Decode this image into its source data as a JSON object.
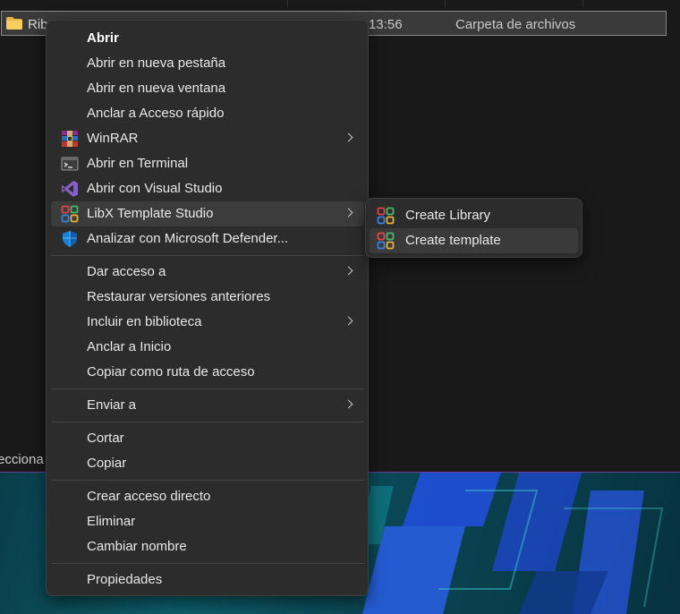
{
  "explorer": {
    "selected_row": {
      "name": "Rib",
      "time": "13:56",
      "type": "Carpeta de archivos"
    },
    "status_text": "ecciona"
  },
  "context_menu": {
    "items": [
      {
        "label": "Abrir",
        "icon": "none",
        "bold": true
      },
      {
        "label": "Abrir en nueva pestaña",
        "icon": "none"
      },
      {
        "label": "Abrir en nueva ventana",
        "icon": "none"
      },
      {
        "label": "Anclar a Acceso rápido",
        "icon": "none"
      },
      {
        "label": "WinRAR",
        "icon": "winrar-icon",
        "submenu": true
      },
      {
        "label": "Abrir en Terminal",
        "icon": "terminal-icon"
      },
      {
        "label": "Abrir con Visual Studio",
        "icon": "visual-studio-icon"
      },
      {
        "label": "LibX Template Studio",
        "icon": "libx-icon",
        "submenu": true,
        "highlighted": true
      },
      {
        "label": "Analizar con Microsoft Defender...",
        "icon": "defender-shield-icon"
      },
      {
        "label": "Dar acceso a",
        "icon": "none",
        "submenu": true
      },
      {
        "label": "Restaurar versiones anteriores",
        "icon": "none"
      },
      {
        "label": "Incluir en biblioteca",
        "icon": "none",
        "submenu": true
      },
      {
        "label": "Anclar a Inicio",
        "icon": "none"
      },
      {
        "label": "Copiar como ruta de acceso",
        "icon": "none"
      },
      {
        "label": "Enviar a",
        "icon": "none",
        "submenu": true
      },
      {
        "label": "Cortar",
        "icon": "none"
      },
      {
        "label": "Copiar",
        "icon": "none"
      },
      {
        "label": "Crear acceso directo",
        "icon": "none"
      },
      {
        "label": "Eliminar",
        "icon": "none"
      },
      {
        "label": "Cambiar nombre",
        "icon": "none"
      },
      {
        "label": "Propiedades",
        "icon": "none"
      }
    ]
  },
  "submenu": {
    "parent": "LibX Template Studio",
    "items": [
      {
        "label": "Create Library",
        "icon": "libx-icon"
      },
      {
        "label": "Create template",
        "icon": "libx-icon",
        "highlighted": true
      }
    ]
  },
  "colors": {
    "menu_background": "#2c2c2c",
    "highlight": "#3c3c3c",
    "text": "#e8e8e8",
    "explorer_background": "#191919",
    "folder_yellow": "#f0c24a",
    "wallpaper_teal": "#0c5e6a",
    "wallpaper_blue": "#1f4fd8"
  }
}
